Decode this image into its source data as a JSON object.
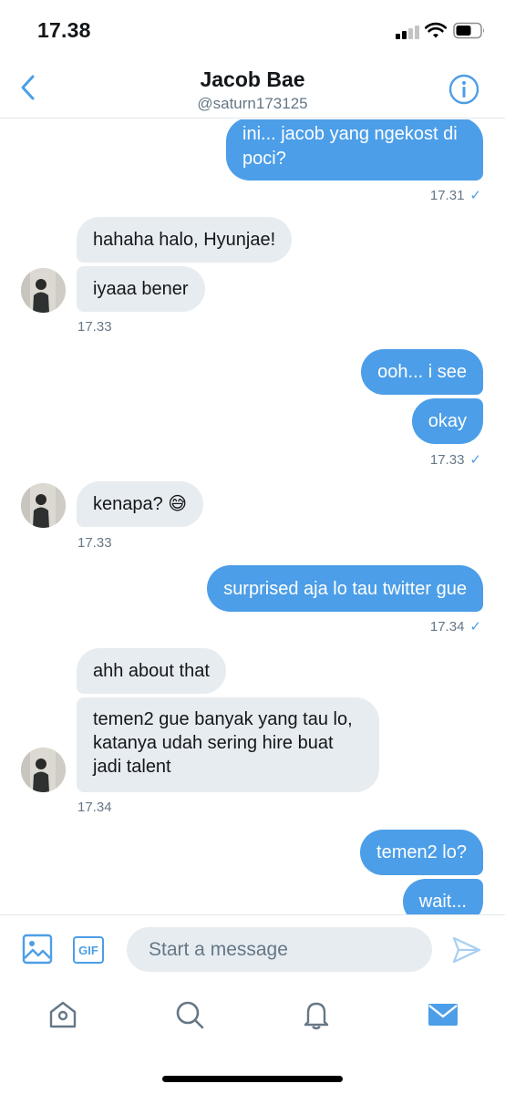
{
  "status_bar": {
    "time": "17.38"
  },
  "header": {
    "name": "Jacob Bae",
    "handle": "@saturn173125",
    "back_icon": "chevron-left-icon",
    "info_icon": "info-icon"
  },
  "colors": {
    "accent": "#4c9ee8",
    "incoming_bubble": "#e6ecf0",
    "meta_text": "#657786"
  },
  "messages": [
    {
      "from": "me",
      "text": "ini... jacob yang ngekost di poci?"
    },
    {
      "from": "me_time",
      "text": "17.31"
    },
    {
      "from": "them",
      "text": "hahaha halo, Hyunjae!"
    },
    {
      "from": "them",
      "text": "iyaaa bener"
    },
    {
      "from": "them_time",
      "text": "17.33"
    },
    {
      "from": "me",
      "text": "ooh... i see"
    },
    {
      "from": "me",
      "text": "okay"
    },
    {
      "from": "me_time",
      "text": "17.33"
    },
    {
      "from": "them",
      "text": "kenapa? 😅"
    },
    {
      "from": "them_time",
      "text": "17.33"
    },
    {
      "from": "me",
      "text": "surprised aja lo tau twitter gue"
    },
    {
      "from": "me_time",
      "text": "17.34"
    },
    {
      "from": "them",
      "text": "ahh about that"
    },
    {
      "from": "them",
      "text": "temen2 gue banyak yang tau lo, katanya udah sering hire buat jadi talent"
    },
    {
      "from": "them_time",
      "text": "17.34"
    },
    {
      "from": "me",
      "text": "temen2 lo?"
    },
    {
      "from": "me",
      "text": "wait..."
    }
  ],
  "read_mark": "✓",
  "composer": {
    "placeholder": "Start a message",
    "gif_label": "GIF",
    "media_icon": "image-icon",
    "send_icon": "send-icon"
  },
  "tabbar": {
    "items": [
      "home-icon",
      "search-icon",
      "bell-icon",
      "mail-icon"
    ]
  }
}
